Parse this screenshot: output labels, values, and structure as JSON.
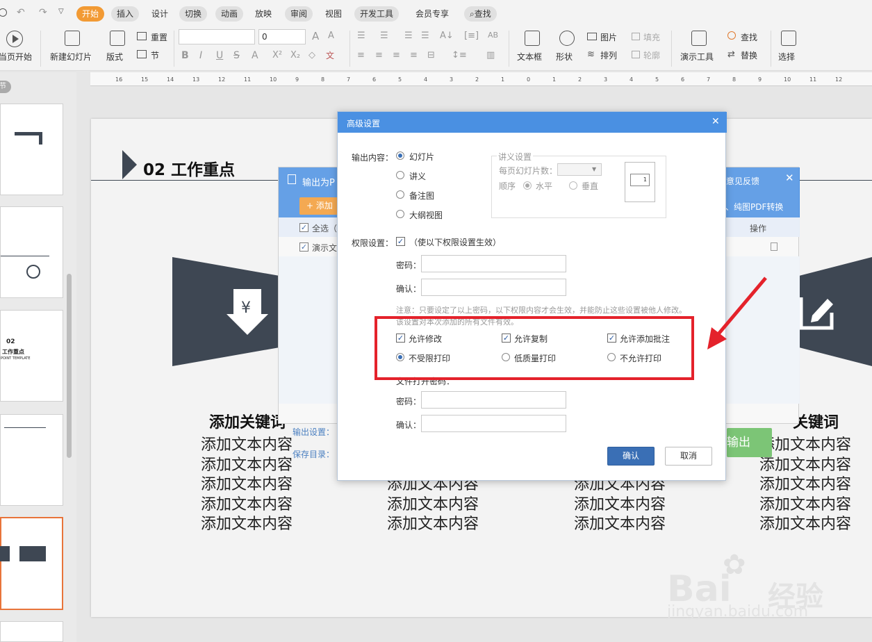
{
  "tabs": [
    "开始",
    "插入",
    "设计",
    "切换",
    "动画",
    "放映",
    "审阅",
    "视图",
    "开发工具",
    "会员专享",
    "查找"
  ],
  "ribbon": {
    "from_start": "当页开始",
    "new_slide": "新建幻灯片",
    "layout": "版式",
    "reset": "重置",
    "section": "节",
    "font_size": "0",
    "text_box": "文本框",
    "shape": "形状",
    "picture": "图片",
    "fill": "填充",
    "arrange": "排列",
    "outline": "轮廓",
    "present_tools": "演示工具",
    "find": "查找",
    "replace": "替换",
    "select": "选择"
  },
  "ruler_ticks": [
    "16",
    "15",
    "14",
    "13",
    "12",
    "11",
    "10",
    "9",
    "8",
    "7",
    "6",
    "5",
    "4",
    "3",
    "2",
    "1",
    "0",
    "1",
    "2",
    "3",
    "4",
    "5",
    "6",
    "7",
    "8",
    "9",
    "10",
    "11",
    "12"
  ],
  "thumbnails": {
    "badge": "节",
    "slide3_num": "02",
    "slide3_title": "工作重点",
    "slide3_sub": "POINT TEMPLATE"
  },
  "slide": {
    "title": "02  工作重点",
    "keywords": [
      "添加关键词",
      "关键词"
    ],
    "body_line": "添加文本内容",
    "col1_lines": [
      "添加文本内容",
      "添加文本内容",
      "添加文本内容",
      "添加文本内容",
      "添加文本内容"
    ],
    "col2_lines": [
      "添加文本内容",
      "添加文本内容"
    ],
    "col3_lines": [
      "添加文本内容",
      "添加文本内容",
      "添加文本内容"
    ],
    "col4_lines": [
      "添加文本内容",
      "添加文本内容",
      "添加文本内容",
      "添加文本内容",
      "添加文本内容"
    ]
  },
  "pdf_dialog": {
    "title": "输出为P",
    "feedback": "意见反馈",
    "add": "添加",
    "convert": "、纯图PDF转换",
    "select_all": "全选（1",
    "file_item": "演示文",
    "ops": "操作",
    "output_settings": "输出设置：",
    "save_dir": "保存目录：",
    "export_btn": "输出"
  },
  "adv": {
    "title": "高级设置",
    "output_label": "输出内容：",
    "output_options": [
      "幻灯片",
      "讲义",
      "备注图",
      "大纲视图"
    ],
    "handout_title": "讲义设置",
    "per_page": "每页幻灯片数：",
    "order": "顺序",
    "horizontal": "水平",
    "vertical": "垂直",
    "preview_num": "1",
    "perm_label": "权限设置：",
    "perm_enable": "（使以下权限设置生效）",
    "password": "密码：",
    "confirm": "确认：",
    "note1": "注意：只要设定了以上密码，以下权限内容才会生效，并能防止这些设置被他人修改。",
    "note2": "该设置对本次添加的所有文件有效。",
    "allow_edit": "允许修改",
    "allow_copy": "允许复制",
    "allow_comment": "允许添加批注",
    "print_unlimited": "不受限打印",
    "print_low": "低质量打印",
    "print_none": "不允许打印",
    "open_pwd_label": "文件打开密码：",
    "ok": "确认",
    "cancel": "取消"
  },
  "watermark": {
    "brand": "Bai",
    "brand2": "经验",
    "url": "jingyan.baidu.com"
  },
  "colors": {
    "accent": "#f29a34",
    "dialog_blue": "#4a90e2",
    "annotation_red": "#e4222b",
    "slide_dark": "#3e4753",
    "export_green": "#7cc576"
  }
}
